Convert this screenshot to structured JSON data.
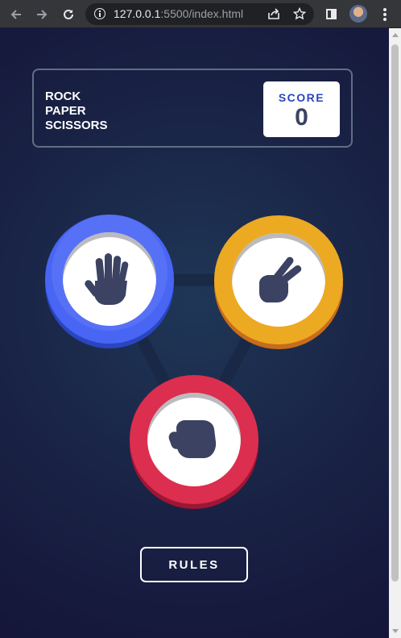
{
  "browser": {
    "url_host": "127.0.0.1",
    "url_rest": ":5500/index.html",
    "icons": [
      "back-arrow-icon",
      "forward-arrow-icon",
      "reload-icon",
      "info-icon",
      "share-icon",
      "star-icon",
      "side-panel-icon",
      "profile-avatar",
      "more-menu-icon"
    ]
  },
  "header": {
    "title_lines": [
      "ROCK",
      "PAPER",
      "SCISSORS"
    ],
    "score_label": "SCORE",
    "score_value": "0"
  },
  "choices": [
    {
      "name": "paper",
      "color": "#4865f4"
    },
    {
      "name": "scissors",
      "color": "#eca922"
    },
    {
      "name": "rock",
      "color": "#dc2e4e"
    }
  ],
  "rules_label": "RULES",
  "colors": {
    "background_dark": "#141539",
    "background_light": "#1f3757",
    "header_outline": "#606e85",
    "score_text": "#2a46c0",
    "dark_text": "#3b4363"
  }
}
